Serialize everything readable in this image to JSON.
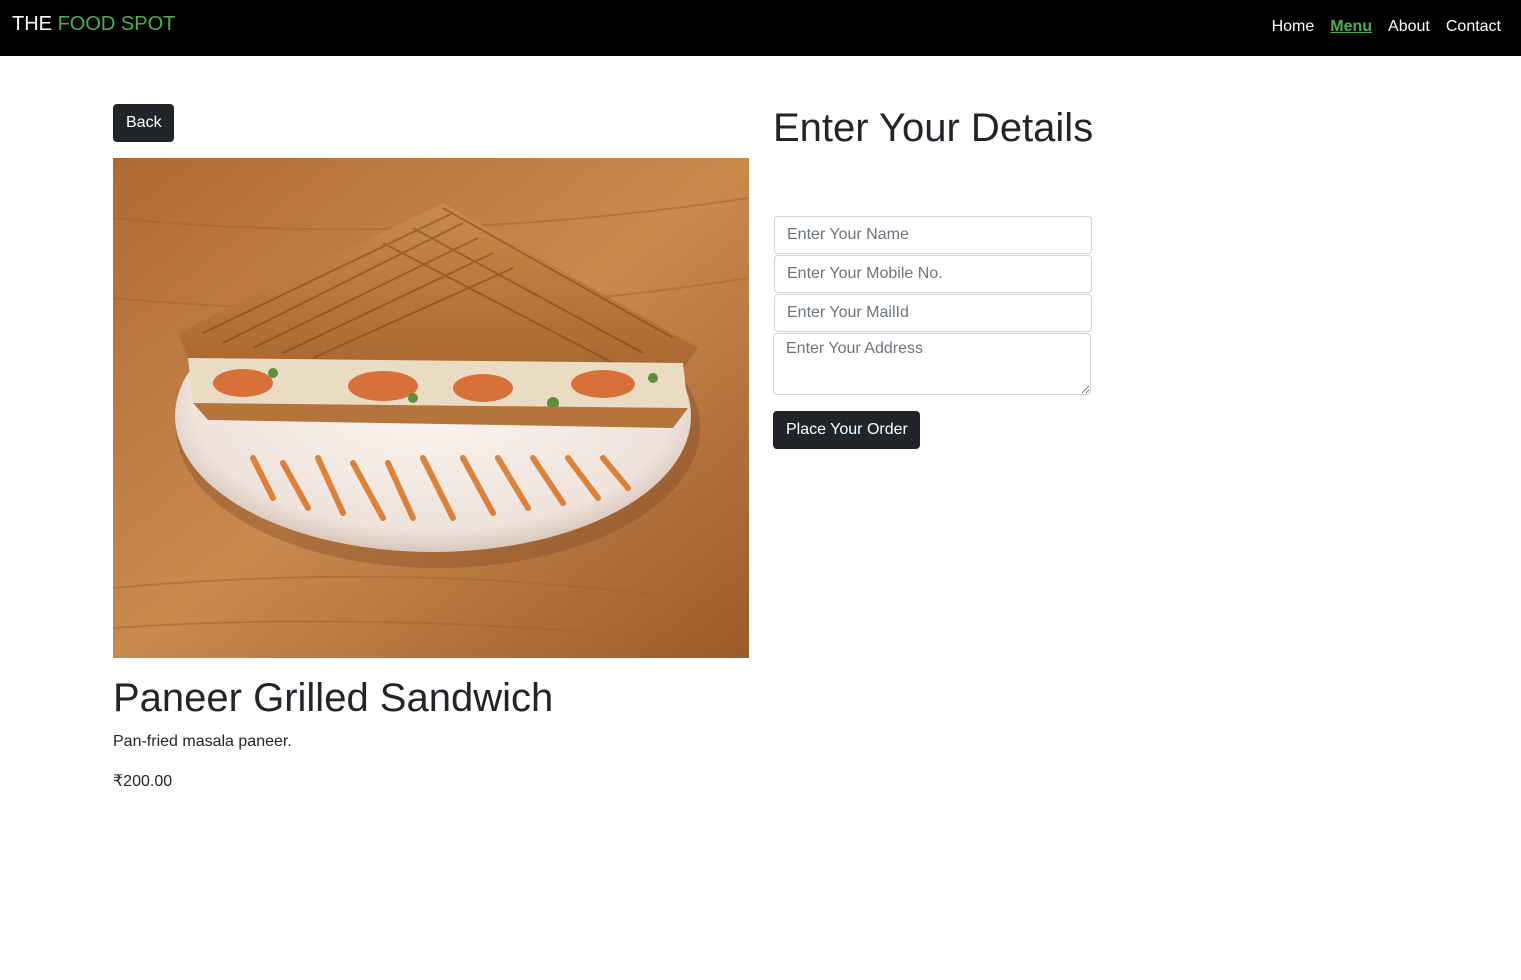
{
  "brand": {
    "prefix": "THE",
    "accent": "FOOD SPOT"
  },
  "nav": {
    "items": [
      "Home",
      "Menu",
      "About",
      "Contact"
    ],
    "active": "Menu"
  },
  "back_label": "Back",
  "item": {
    "name": "Paneer Grilled Sandwich",
    "description": "Pan-fried masala paneer.",
    "price": "₹200.00"
  },
  "form": {
    "title": "Enter Your Details",
    "name_placeholder": "Enter Your Name",
    "mobile_placeholder": "Enter Your Mobile No.",
    "mail_placeholder": "Enter Your MailId",
    "address_placeholder": "Enter Your Address",
    "submit_label": "Place Your Order"
  },
  "colors": {
    "navbar_bg": "#000000",
    "accent": "#4caf50",
    "button_dark": "#212529"
  }
}
